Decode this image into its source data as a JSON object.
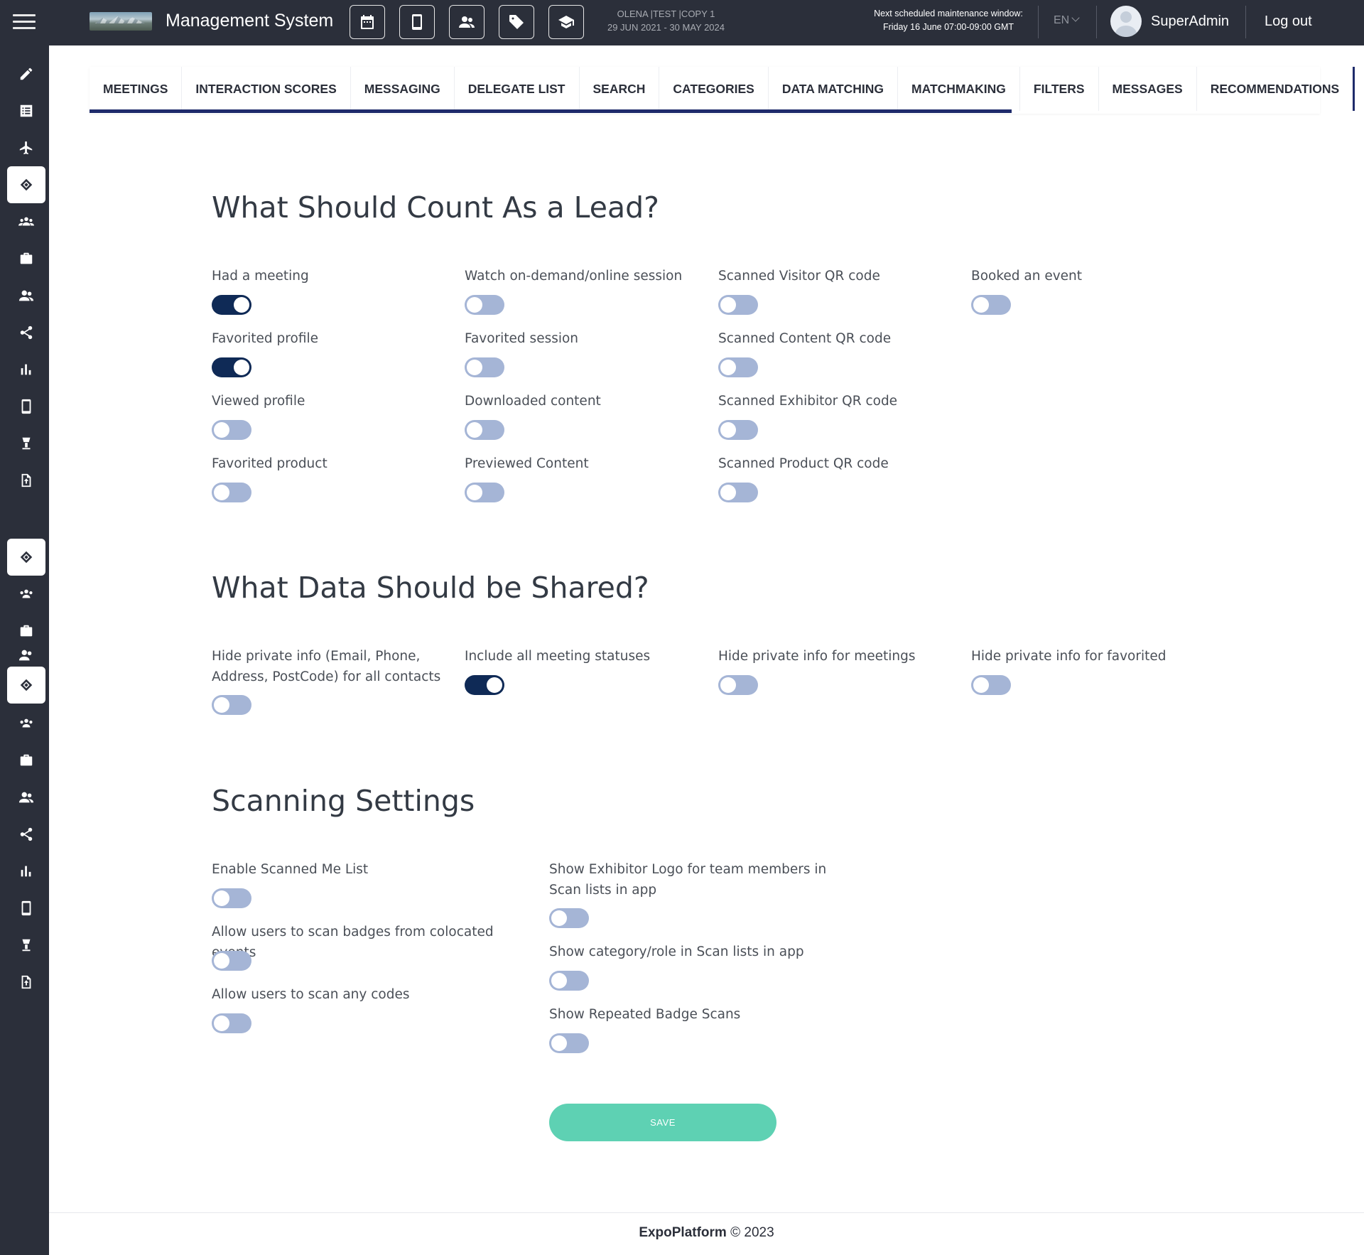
{
  "header": {
    "app_title": "Management System",
    "event_name": "OLENA |TEST |COPY 1",
    "event_dates": "29 JUN 2021 - 30 MAY 2024",
    "maintenance_line1": "Next scheduled maintenance window:",
    "maintenance_line2": "Friday 16 June 07:00-09:00 GMT",
    "language": "EN",
    "username": "SuperAdmin",
    "logout": "Log out",
    "tools": [
      "calendar-icon",
      "mobile-icon",
      "users-icon",
      "tag-icon",
      "graduation-cap-icon"
    ]
  },
  "tabs": [
    "MEETINGS",
    "INTERACTION SCORES",
    "MESSAGING",
    "DELEGATE LIST",
    "SEARCH",
    "CATEGORIES",
    "DATA MATCHING",
    "MATCHMAKING",
    "FILTERS",
    "MESSAGES",
    "RECOMMENDATIONS"
  ],
  "lead_section": {
    "title": "What Should Count As a Lead?",
    "options": [
      {
        "label": "Had a meeting",
        "on": true
      },
      {
        "label": "Favorited profile",
        "on": true
      },
      {
        "label": "Viewed profile",
        "on": false
      },
      {
        "label": "Favorited product",
        "on": false
      },
      {
        "label": "Watch on-demand/online session",
        "on": false
      },
      {
        "label": "Favorited session",
        "on": false
      },
      {
        "label": "Downloaded content",
        "on": false
      },
      {
        "label": "Previewed Content",
        "on": false
      },
      {
        "label": "Scanned Visitor QR code",
        "on": false
      },
      {
        "label": "Scanned Content QR code",
        "on": false
      },
      {
        "label": "Scanned Exhibitor QR code",
        "on": false
      },
      {
        "label": "Scanned Product QR code",
        "on": false
      },
      {
        "label": "Booked an event",
        "on": false
      }
    ]
  },
  "share_section": {
    "title": "What Data Should be Shared?",
    "options": [
      {
        "label": "Hide private info (Email, Phone, Address, PostCode) for all contacts",
        "on": false
      },
      {
        "label": "Include all meeting statuses",
        "on": true
      },
      {
        "label": "Hide private info for meetings",
        "on": false
      },
      {
        "label": "Hide private info for favorited",
        "on": false
      }
    ]
  },
  "scan_section": {
    "title": "Scanning Settings",
    "options": [
      {
        "label": "Enable Scanned Me List",
        "on": false
      },
      {
        "label": "Allow users to scan badges from colocated events",
        "on": false
      },
      {
        "label": "Allow users to scan any codes",
        "on": false
      },
      {
        "label": "Show Exhibitor Logo for team members in Scan lists in app",
        "on": false
      },
      {
        "label": "Show category/role in Scan lists in app",
        "on": false
      },
      {
        "label": "Show Repeated Badge Scans",
        "on": false
      }
    ]
  },
  "save_label": "SAVE",
  "footer": {
    "brand": "ExpoPlatform",
    "copyright": "© 2023"
  },
  "colors": {
    "topbar": "#2b2f3a",
    "toggle_on": "#0f2a56",
    "toggle_off": "#a5b5d6",
    "save": "#5ed1b3",
    "tab_accent": "#1f2b6b"
  }
}
